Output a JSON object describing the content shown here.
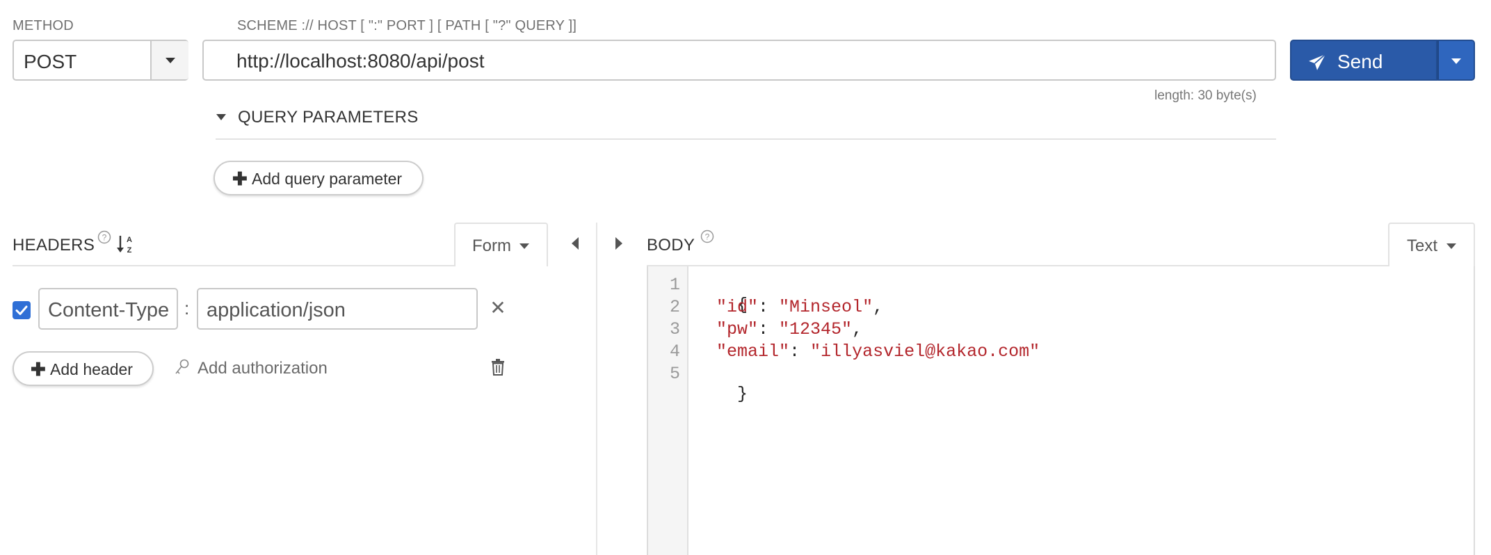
{
  "method": {
    "label": "METHOD",
    "value": "POST"
  },
  "url": {
    "label": "SCHEME :// HOST [ \":\" PORT ] [ PATH [ \"?\" QUERY ]]",
    "value": "http://localhost:8080/api/post",
    "length_text": "length: 30 byte(s)"
  },
  "send": {
    "label": "Send",
    "accent": "#2a5aa8"
  },
  "query": {
    "title": "QUERY PARAMETERS",
    "add_label": "Add query parameter"
  },
  "headers": {
    "title": "HEADERS",
    "mode": "Form",
    "rows": [
      {
        "checked": true,
        "name": "Content-Type",
        "separator": ":",
        "value": "application/json"
      }
    ],
    "add_header_label": "Add header",
    "add_auth_label": "Add authorization"
  },
  "body": {
    "title": "BODY",
    "mode": "Text",
    "line_numbers": [
      "1",
      "2",
      "3",
      "4",
      "5"
    ],
    "lines": [
      {
        "open": "{"
      },
      {
        "key": "\"id\"",
        "colon": ": ",
        "val": "\"Minseol\"",
        "comma": ","
      },
      {
        "key": "\"pw\"",
        "colon": ": ",
        "val": "\"12345\"",
        "comma": ","
      },
      {
        "key": "\"email\"",
        "colon": ": ",
        "val": "\"illyasviel@kakao.com\"",
        "comma": ""
      },
      {
        "open": "}"
      }
    ]
  },
  "icons": {
    "send": "paper-plane-icon",
    "help": "question-circle-icon",
    "sort": "sort-alpha-icon",
    "remove": "close-icon",
    "trash": "trash-icon",
    "key": "key-icon"
  }
}
